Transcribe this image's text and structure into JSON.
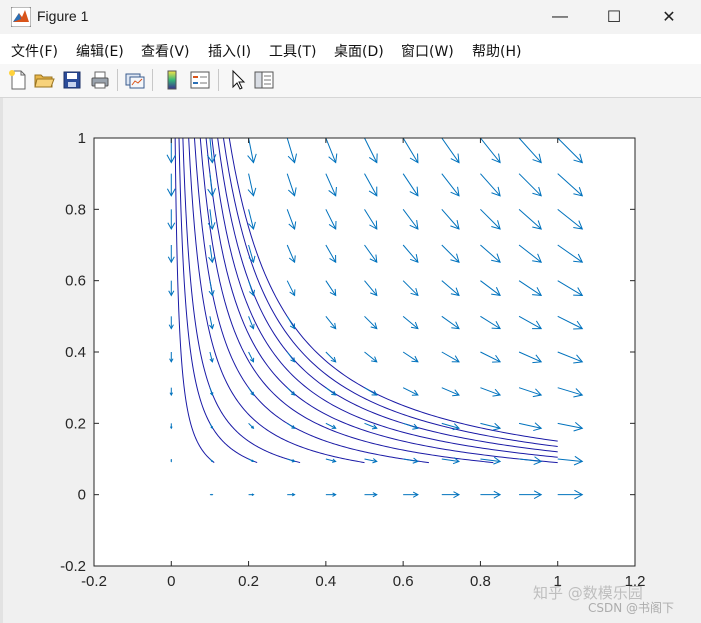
{
  "window": {
    "title": "Figure 1",
    "minimize_glyph": "—",
    "maximize_glyph": "☐",
    "close_glyph": "✕",
    "app_icon": "matlab-icon"
  },
  "menu": {
    "items": [
      "文件(F)",
      "编辑(E)",
      "查看(V)",
      "插入(I)",
      "工具(T)",
      "桌面(D)",
      "窗口(W)",
      "帮助(H)"
    ],
    "dock_glyph": "↘"
  },
  "toolbar": {
    "buttons": [
      "new-figure-icon",
      "open-file-icon",
      "save-icon",
      "print-icon",
      "link-plot-icon",
      "insert-colorbar-icon",
      "insert-legend-icon",
      "edit-plot-icon",
      "property-inspector-icon"
    ]
  },
  "chart_data": {
    "type": "quiver+line",
    "title": "",
    "xlabel": "",
    "ylabel": "",
    "xlim": [
      -0.2,
      1.2
    ],
    "ylim": [
      -0.2,
      1.0
    ],
    "xticks": [
      "-0.2",
      "0",
      "0.2",
      "0.4",
      "0.6",
      "0.8",
      "1",
      "1.2"
    ],
    "yticks": [
      "-0.2",
      "0",
      "0.2",
      "0.4",
      "0.6",
      "0.8",
      "1"
    ],
    "grid": false,
    "colors": {
      "quiver": "#0072BD",
      "streamlines": "#1a1aa6",
      "axes": "#262626"
    },
    "quiver": {
      "x": [
        0,
        0.1,
        0.2,
        0.3,
        0.4,
        0.5,
        0.6,
        0.7,
        0.8,
        0.9,
        1.0
      ],
      "y": [
        0,
        0.1,
        0.2,
        0.3,
        0.4,
        0.5,
        0.6,
        0.7,
        0.8,
        0.9,
        1.0
      ],
      "u_formula": "x",
      "v_formula": "-y"
    },
    "streamlines": {
      "formula": "x*y = c",
      "c": [
        0.01,
        0.02,
        0.03,
        0.045,
        0.06,
        0.075,
        0.09,
        0.105,
        0.12,
        0.135,
        0.15
      ],
      "x_range": [
        0.0,
        1.0
      ],
      "y_range": [
        0.09,
        1.0
      ]
    }
  },
  "watermark": {
    "text": "知乎 @数模乐园",
    "text2": "CSDN @书阁下"
  }
}
